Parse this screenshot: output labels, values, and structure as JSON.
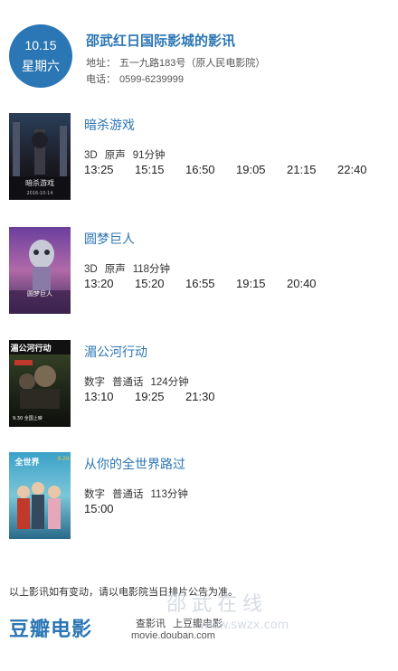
{
  "header": {
    "date": "10.15",
    "weekday": "星期六",
    "cinema_name": "邵武红日国际影城的影讯",
    "address_label": "地址：",
    "address": "五一九路183号（原人民电影院）",
    "phone_label": "电话：",
    "phone": "0599-6239999"
  },
  "movies": [
    {
      "title": "暗杀游戏",
      "format": "3D",
      "language": "原声",
      "duration": "91分钟",
      "times": [
        "13:25",
        "15:15",
        "16:50",
        "19:05",
        "21:15",
        "22:40"
      ],
      "poster_text": "暗杀游戏",
      "poster_date": "2016-10-14"
    },
    {
      "title": "圆梦巨人",
      "format": "3D",
      "language": "原声",
      "duration": "118分钟",
      "times": [
        "13:20",
        "15:20",
        "16:55",
        "19:15",
        "20:40"
      ],
      "poster_text": "圆梦巨人"
    },
    {
      "title": "湄公河行动",
      "format": "数字",
      "language": "普通话",
      "duration": "124分钟",
      "times": [
        "13:10",
        "19:25",
        "21:30"
      ],
      "poster_text": "湄公河行动",
      "poster_date": "9.30 全国上映"
    },
    {
      "title": "从你的全世界路过",
      "format": "数字",
      "language": "普通话",
      "duration": "113分钟",
      "times": [
        "15:00"
      ],
      "poster_text": "全世界",
      "poster_date": "9.29"
    }
  ],
  "disclaimer": "以上影讯如有变动，请以电影院当日排片公告为准。",
  "footer": {
    "logo": "豆瓣电影",
    "link1": "查影讯",
    "link2": "上豆瓣电影",
    "url": "movie.douban.com"
  },
  "watermark": {
    "text": "邵武在线",
    "url": "www.swzx.com"
  },
  "colors": {
    "accent": "#2b76b4"
  }
}
